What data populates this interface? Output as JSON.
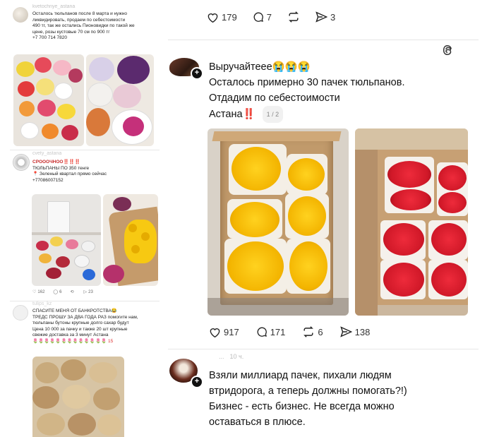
{
  "left_post1": {
    "username": "kvetochnye_astana",
    "lines": [
      "Осталось тюльпанов после 8 марта и нужно",
      "ликвидировать, продаем по себестоимости",
      "490 тг, так же остались Пионовидки по такой же",
      "цене, розы кустовые 70 см по 900 тг",
      "+7 700 714 7820"
    ]
  },
  "left_post2": {
    "username": "cvety_astana",
    "lines": [
      "СРОООЧНОО‼️‼️‼️",
      "ТЮЛЬПАНЫ ПО 350 тенге",
      "📍 Зеленый квартал прямо сейчас",
      "+77086007152"
    ],
    "actions": {
      "likes": "162",
      "comments": "6",
      "reposts": "",
      "shares": "23"
    }
  },
  "left_post3": {
    "username": "tulips_kz",
    "lines": [
      "СПАСИТЕ МЕНЯ ОТ БАНКРОТСТВА😂",
      "ТРЕДС ПРОШУ ЗА ДВА ГОДА РАЗ помогите нам,",
      "тюльпаны бутоны крупные долго сахар будут",
      "Цена 10 000 за пачку и также 20 шт крупные",
      "свежие доставка за 3 минут Астана",
      "🌷🌷🌷🌷🌷🌷🌷🌷🌷🌷🌷🌷🌷 15"
    ]
  },
  "top_actions": {
    "likes": "179",
    "comments": "7",
    "shares": "3"
  },
  "main_post": {
    "line1": "Выручайтеее😭😭😭",
    "line2": "Осталось примерно 30 пачек тюльпанов.",
    "line3": "Отдадим по себестоимости",
    "city": "Астана‼️",
    "pager": "1 / 2",
    "actions": {
      "likes": "917",
      "comments": "171",
      "reposts": "6",
      "shares": "138"
    }
  },
  "reply_post": {
    "username": "...",
    "time": "10 ч.",
    "line1": "Взяли миллиард пачек, пихали людям",
    "line2": "втридорога, а теперь должны помогать?!)",
    "line3": "Бизнес - есть бизнес. Не всегда можно",
    "line4": "оставаться в плюсе."
  },
  "icons": {
    "threads_logo": "threads-logo-icon",
    "like": "heart-icon",
    "comment": "comment-bubble-icon",
    "repost": "repost-icon",
    "share": "send-icon",
    "follow": "plus-icon"
  },
  "colors": {
    "tulip_yellow": "#f4c20d",
    "tulip_red": "#d91c2a",
    "box": "#c9a57a"
  }
}
